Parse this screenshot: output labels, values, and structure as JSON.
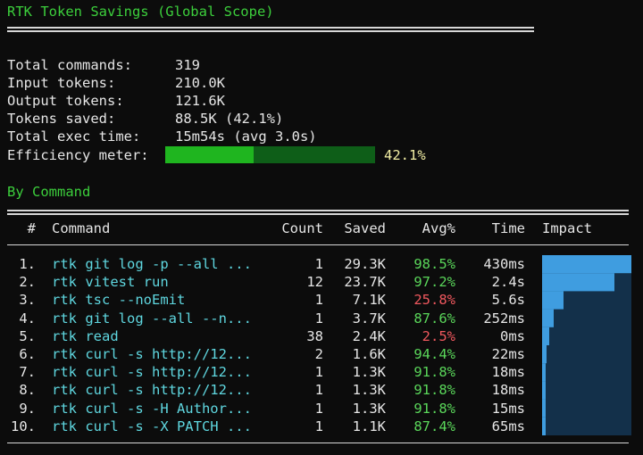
{
  "title": "RTK Token Savings (Global Scope)",
  "summary": [
    {
      "label": "Total commands:",
      "value": "319"
    },
    {
      "label": "Input tokens:",
      "value": "210.0K"
    },
    {
      "label": "Output tokens:",
      "value": "121.6K"
    },
    {
      "label": "Tokens saved:",
      "value": "88.5K (42.1%)"
    },
    {
      "label": "Total exec time:",
      "value": "15m54s (avg 3.0s)"
    }
  ],
  "efficiency": {
    "label": "Efficiency meter:",
    "percent_text": "42.1%",
    "fraction": 0.421
  },
  "section_title": "By Command",
  "table": {
    "headers": {
      "idx": "#",
      "command": "Command",
      "count": "Count",
      "saved": "Saved",
      "avg": "Avg%",
      "time": "Time",
      "impact": "Impact"
    },
    "rows": [
      {
        "idx": "1.",
        "command": "rtk git log -p --all ...",
        "count": "1",
        "saved": "29.3K",
        "avg": "98.5%",
        "avg_status": "good",
        "time": "430ms",
        "impact": 1.0
      },
      {
        "idx": "2.",
        "command": "rtk vitest run",
        "count": "12",
        "saved": "23.7K",
        "avg": "97.2%",
        "avg_status": "good",
        "time": "2.4s",
        "impact": 0.81
      },
      {
        "idx": "3.",
        "command": "rtk tsc --noEmit",
        "count": "1",
        "saved": "7.1K",
        "avg": "25.8%",
        "avg_status": "bad",
        "time": "5.6s",
        "impact": 0.24
      },
      {
        "idx": "4.",
        "command": "rtk git log --all --n...",
        "count": "1",
        "saved": "3.7K",
        "avg": "87.6%",
        "avg_status": "good",
        "time": "252ms",
        "impact": 0.13
      },
      {
        "idx": "5.",
        "command": "rtk read",
        "count": "38",
        "saved": "2.4K",
        "avg": "2.5%",
        "avg_status": "bad",
        "time": "0ms",
        "impact": 0.08
      },
      {
        "idx": "6.",
        "command": "rtk curl -s http://12...",
        "count": "2",
        "saved": "1.6K",
        "avg": "94.4%",
        "avg_status": "good",
        "time": "22ms",
        "impact": 0.05
      },
      {
        "idx": "7.",
        "command": "rtk curl -s http://12...",
        "count": "1",
        "saved": "1.3K",
        "avg": "91.8%",
        "avg_status": "good",
        "time": "18ms",
        "impact": 0.04
      },
      {
        "idx": "8.",
        "command": "rtk curl -s http://12...",
        "count": "1",
        "saved": "1.3K",
        "avg": "91.8%",
        "avg_status": "good",
        "time": "18ms",
        "impact": 0.04
      },
      {
        "idx": "9.",
        "command": "rtk curl -s -H Author...",
        "count": "1",
        "saved": "1.3K",
        "avg": "91.8%",
        "avg_status": "good",
        "time": "15ms",
        "impact": 0.04
      },
      {
        "idx": "10.",
        "command": "rtk curl -s -X PATCH ...",
        "count": "1",
        "saved": "1.1K",
        "avg": "87.4%",
        "avg_status": "good",
        "time": "65ms",
        "impact": 0.04
      }
    ]
  },
  "colors": {
    "header_green": "#3ccf3c",
    "meter_fill": "#1fb51f",
    "meter_empty": "#0e5e18",
    "impact_fill": "#3f9de0",
    "impact_empty": "#13304a",
    "good": "#5ad65a",
    "bad": "#f0585e",
    "command": "#5fd7e0"
  }
}
